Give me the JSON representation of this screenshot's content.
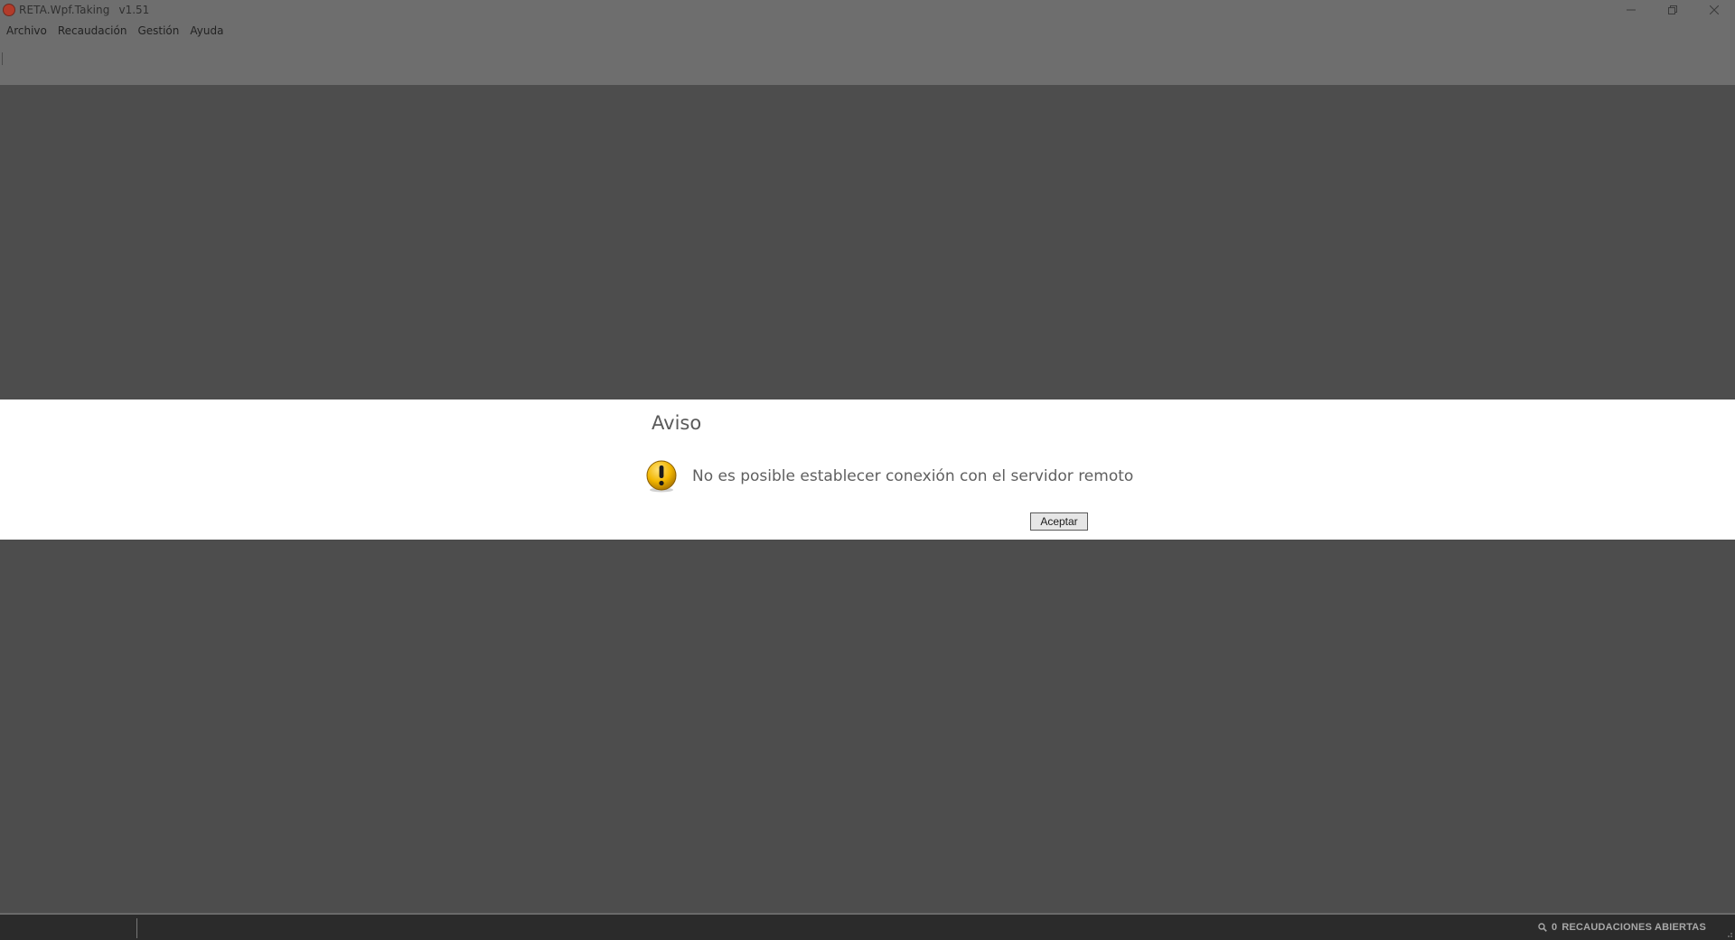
{
  "window": {
    "title": "RETA.Wpf.Taking",
    "version": "v1.51",
    "controls": {
      "minimize_icon": "minimize-icon",
      "restore_icon": "restore-icon",
      "close_icon": "close-icon"
    }
  },
  "menu": {
    "items": [
      {
        "label": "Archivo"
      },
      {
        "label": "Recaudación"
      },
      {
        "label": "Gestión"
      },
      {
        "label": "Ayuda"
      }
    ]
  },
  "dialog": {
    "title": "Aviso",
    "icon": "warning-icon",
    "message": "No es posible establecer conexión con el servidor remoto",
    "button_label": "Aceptar"
  },
  "statusbar": {
    "search_icon": "search-icon",
    "open_count": "0",
    "open_label": "RECAUDACIONES ABIERTAS"
  },
  "colors": {
    "overlay": "#4d4d4d",
    "chrome": "#6e6e6e",
    "dialog_bg": "#ffffff",
    "statusbar_bg": "#2b2b2b",
    "warning_yellow": "#f2b600"
  }
}
